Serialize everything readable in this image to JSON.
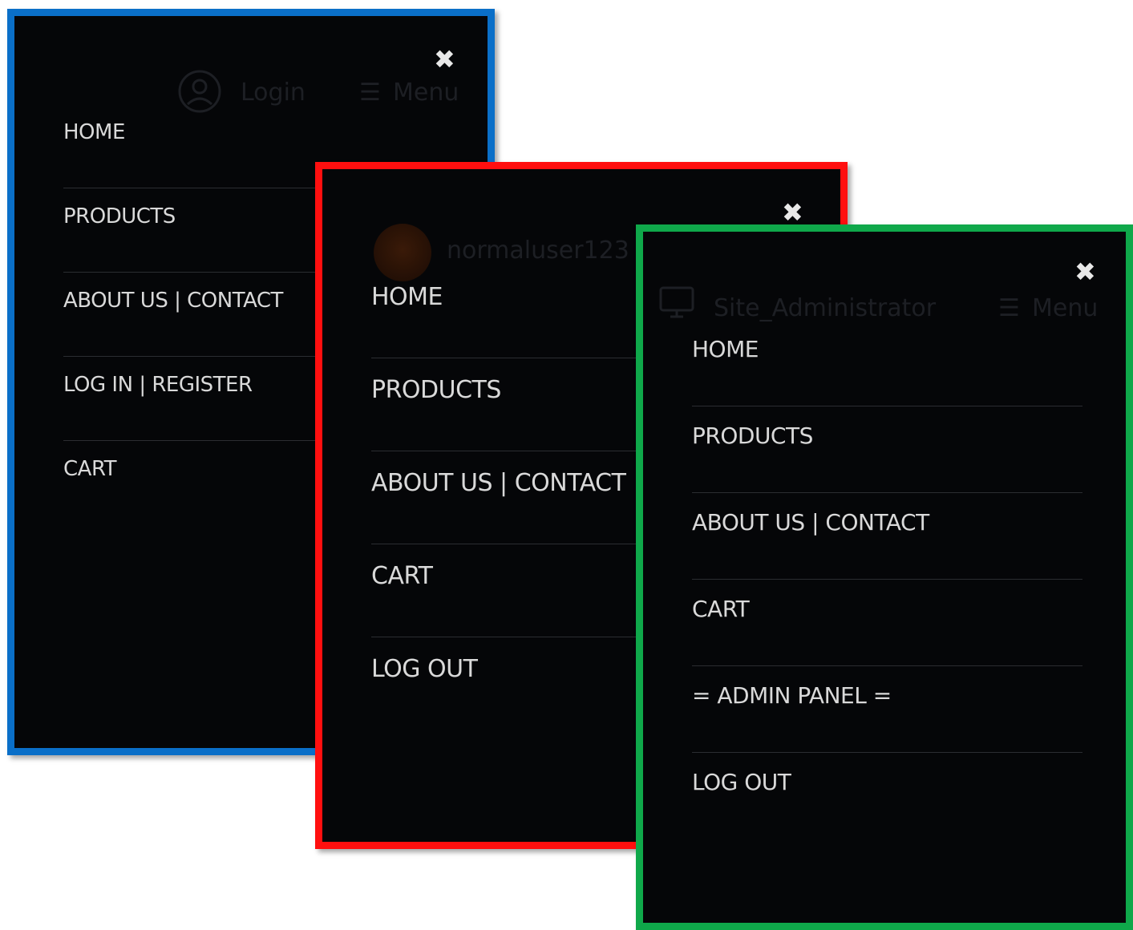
{
  "panels": {
    "guest": {
      "border_color": "#0a6fc8",
      "header": {
        "login_label": "Login",
        "menu_label": "Menu"
      },
      "menu": [
        "HOME",
        "PRODUCTS",
        "ABOUT US | CONTACT",
        "LOG IN | REGISTER",
        "CART"
      ]
    },
    "user": {
      "border_color": "#ff0f0f",
      "header": {
        "username": "normaluser123"
      },
      "menu": [
        "HOME",
        "PRODUCTS",
        "ABOUT US | CONTACT",
        "CART",
        "LOG OUT"
      ]
    },
    "admin": {
      "border_color": "#0fa84a",
      "header": {
        "username": "Site_Administrator",
        "menu_label": "Menu"
      },
      "menu": [
        "HOME",
        "PRODUCTS",
        "ABOUT US | CONTACT",
        "CART",
        "= ADMIN PANEL =",
        "LOG OUT"
      ]
    }
  },
  "icons": {
    "close": "close-icon",
    "user": "user-circle-icon",
    "hamburger": "hamburger-icon",
    "monitor": "monitor-icon"
  },
  "close_glyph": "✖",
  "hamburger_glyph": "☰"
}
